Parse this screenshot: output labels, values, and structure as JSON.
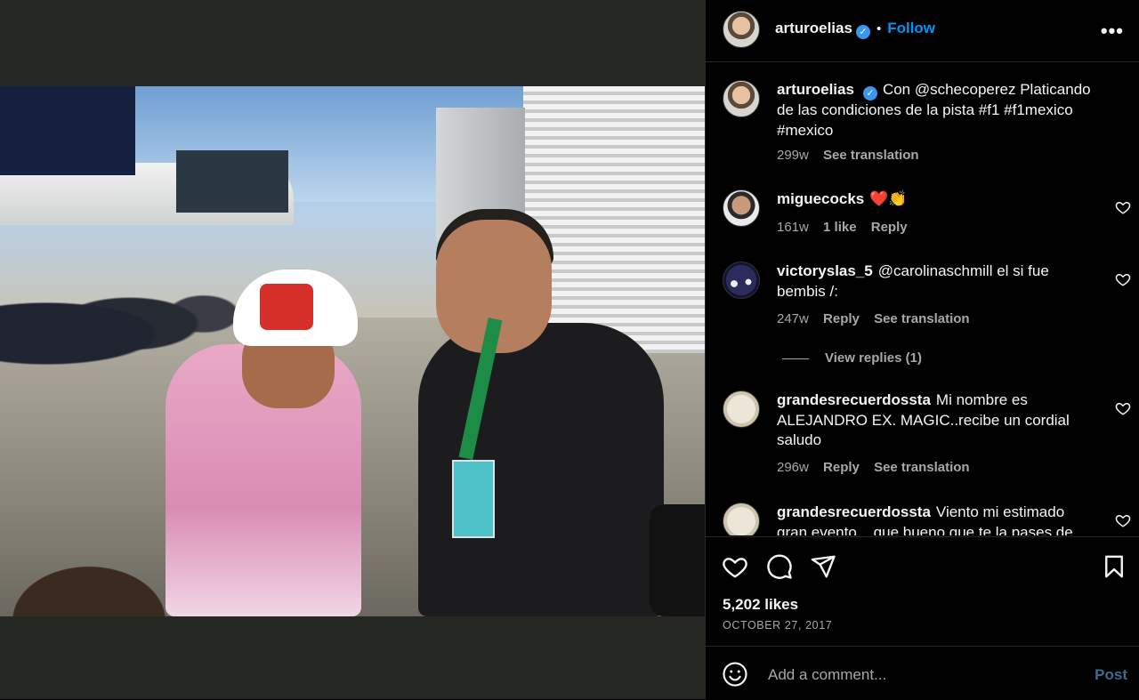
{
  "post": {
    "author": "arturoelias",
    "follow_label": "Follow",
    "separator": "•",
    "more_label": "•••",
    "verified_mark": "✓",
    "photo_description_icon": "image-photo",
    "caption": {
      "username": "arturoelias",
      "text": "Con @schecoperez Platicando de las condiciones de la pista #f1 #f1mexico #mexico",
      "age": "299w",
      "see_translation": "See translation"
    },
    "likes": "5,202 likes",
    "date": "OCTOBER 27, 2017"
  },
  "comments": [
    {
      "username": "miguecocks",
      "text": "❤️👏",
      "age": "161w",
      "likes": "1 like",
      "reply": "Reply"
    },
    {
      "username": "victoryslas_5",
      "text": "@carolinaschmill el si fue bembis /:",
      "age": "247w",
      "reply": "Reply",
      "see_translation": "See translation",
      "view_replies": "View replies (1)"
    },
    {
      "username": "grandesrecuerdossta",
      "text": "Mi nombre es ALEJANDRO EX. MAGIC..recibe un cordial saludo",
      "age": "296w",
      "reply": "Reply",
      "see_translation": "See translation"
    },
    {
      "username": "grandesrecuerdossta",
      "text": "Viento mi estimado gran evento... que bueno que te la pases de"
    }
  ],
  "comment_input": {
    "placeholder": "Add a comment...",
    "post_label": "Post"
  },
  "colors": {
    "background": "#000000",
    "media_background": "#252723",
    "link_blue": "#0095f6",
    "muted_text": "#a8a8a8",
    "verified_blue": "#3897f0"
  }
}
